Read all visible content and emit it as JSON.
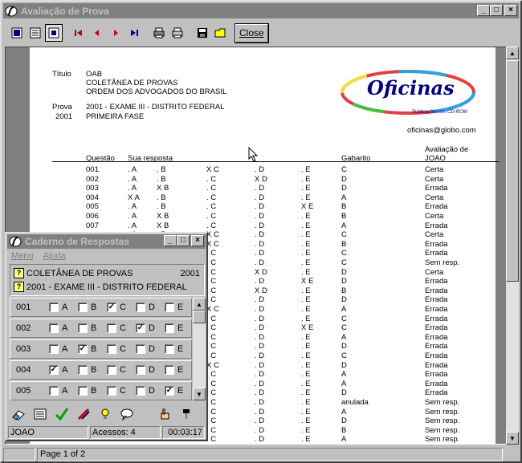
{
  "window": {
    "title": "Avaliação de Prova",
    "minimize": "_",
    "maximize": "□",
    "close": "×"
  },
  "toolbar": {
    "close_label": "Close"
  },
  "status": {
    "page": "Page 1 of 2"
  },
  "report": {
    "titulo_label": "Título",
    "titulo_lines": [
      "OAB",
      "COLETÂNEA DE PROVAS",
      "ORDEM DOS ADVOGADOS DO BRASIL"
    ],
    "prova_label": "Prova",
    "prova_year": "2001",
    "prova_lines": [
      "2001 - EXAME III - DISTRITO FEDERAL",
      "PRIMEIRA FASE"
    ],
    "logo_text": "Oficinas",
    "logo_sub": "Publicações em CD-ROM",
    "email": "oficinas@globo.com",
    "headers": {
      "questao": "Questão",
      "resposta": "Sua resposta",
      "gabarito": "Gabarito",
      "aval1": "Avaliação de",
      "aval2": "JOAO"
    },
    "rows": [
      {
        "q": "001",
        "marks": [
          ".",
          " .",
          "X",
          ".",
          " .",
          "."
        ],
        "g": "C",
        "r": "Certa"
      },
      {
        "q": "002",
        "marks": [
          ".",
          ".",
          ".",
          "X",
          ".",
          "."
        ],
        "g": "D",
        "r": "Certa"
      },
      {
        "q": "003",
        "marks": [
          ".",
          "X",
          ".",
          ".",
          ".",
          "."
        ],
        "g": "D",
        "r": "Errada"
      },
      {
        "q": "004",
        "marks": [
          "X",
          ".",
          ".",
          ".",
          ".",
          "."
        ],
        "g": "A",
        "r": "Certa"
      },
      {
        "q": "005",
        "marks": [
          ".",
          ".",
          ".",
          ".",
          "X",
          "."
        ],
        "g": "B",
        "r": "Errada"
      },
      {
        "q": "006",
        "marks": [
          ".",
          "X",
          ".",
          ".",
          ".",
          "."
        ],
        "g": "B",
        "r": "Certa"
      },
      {
        "q": "007",
        "marks": [
          ".",
          "X",
          ".",
          ".",
          ".",
          "."
        ],
        "g": "A",
        "r": "Errada"
      },
      {
        "q": "",
        "marks": [
          "",
          "",
          "X",
          "",
          "",
          ""
        ],
        "g": "C",
        "r": "Certa"
      },
      {
        "q": "",
        "marks": [
          "",
          "",
          "X",
          "",
          "",
          ""
        ],
        "g": "B",
        "r": "Errada"
      },
      {
        "q": "",
        "marks": [
          "",
          "",
          "",
          "",
          "",
          ""
        ],
        "g": "C",
        "r": "Errada"
      },
      {
        "q": "",
        "marks": [
          "",
          "",
          "",
          "",
          "",
          ""
        ],
        "g": "C",
        "r": "Sem resp."
      },
      {
        "q": "",
        "marks": [
          "",
          "",
          "",
          "X",
          "",
          ""
        ],
        "g": "D",
        "r": "Certa"
      },
      {
        "q": "",
        "marks": [
          "",
          "",
          "",
          "",
          "X",
          ""
        ],
        "g": "D",
        "r": "Errada"
      },
      {
        "q": "",
        "marks": [
          "",
          "",
          "",
          "X",
          "",
          ""
        ],
        "g": "B",
        "r": "Errada"
      },
      {
        "q": "",
        "marks": [
          "",
          "",
          "",
          "",
          "",
          ""
        ],
        "g": "D",
        "r": "Errada"
      },
      {
        "q": "",
        "marks": [
          "",
          "",
          "X",
          "",
          "",
          ""
        ],
        "g": "A",
        "r": "Errada"
      },
      {
        "q": "",
        "marks": [
          "",
          "",
          "",
          "",
          "",
          ""
        ],
        "g": "C",
        "r": "Errada"
      },
      {
        "q": "",
        "marks": [
          "",
          "",
          "",
          "",
          "X",
          ""
        ],
        "g": "C",
        "r": "Errada"
      },
      {
        "q": "",
        "marks": [
          "",
          "",
          "",
          "",
          "",
          ""
        ],
        "g": "A",
        "r": "Errada"
      },
      {
        "q": "",
        "marks": [
          "",
          "",
          "",
          "",
          "",
          ""
        ],
        "g": "D",
        "r": "Errada"
      },
      {
        "q": "",
        "marks": [
          "",
          "",
          "",
          "",
          "",
          ""
        ],
        "g": "C",
        "r": "Errada"
      },
      {
        "q": "",
        "marks": [
          "",
          "",
          "X",
          "",
          "",
          ""
        ],
        "g": "D",
        "r": "Errada"
      },
      {
        "q": "",
        "marks": [
          "",
          "",
          "",
          "",
          "",
          ""
        ],
        "g": "A",
        "r": "Errada"
      },
      {
        "q": "",
        "marks": [
          "",
          "",
          "",
          "",
          "",
          ""
        ],
        "g": "A",
        "r": "Errada"
      },
      {
        "q": "",
        "marks": [
          "",
          "",
          "",
          "",
          "",
          ""
        ],
        "g": "D",
        "r": "Errada"
      },
      {
        "q": "",
        "marks": [
          "",
          "",
          "",
          "",
          "",
          ""
        ],
        "g": "anulada",
        "r": "Sem resp."
      },
      {
        "q": "",
        "marks": [
          "",
          "",
          "",
          "",
          "",
          ""
        ],
        "g": "A",
        "r": "Sem resp."
      },
      {
        "q": "",
        "marks": [
          "",
          "",
          "",
          "",
          "",
          ""
        ],
        "g": "D",
        "r": "Sem resp."
      },
      {
        "q": "",
        "marks": [
          "",
          "",
          "",
          "",
          "",
          ""
        ],
        "g": "B",
        "r": "Sem resp."
      },
      {
        "q": "",
        "marks": [
          "",
          "",
          "",
          "",
          "",
          ""
        ],
        "g": "A",
        "r": "Sem resp."
      }
    ]
  },
  "caderno": {
    "title": "Caderno de Respostas",
    "menu": [
      "Menu",
      "Ajuda"
    ],
    "line1": "COLETÂNEA DE PROVAS",
    "line1_year": "2001",
    "line2": "2001 - EXAME III - DISTRITO FEDERAL",
    "options": [
      "A",
      "B",
      "C",
      "D",
      "E"
    ],
    "questions": [
      {
        "num": "001",
        "checked": [
          false,
          false,
          true,
          false,
          false
        ]
      },
      {
        "num": "002",
        "checked": [
          false,
          false,
          false,
          true,
          false
        ]
      },
      {
        "num": "003",
        "checked": [
          false,
          true,
          false,
          false,
          false
        ]
      },
      {
        "num": "004",
        "checked": [
          true,
          false,
          false,
          false,
          false
        ]
      },
      {
        "num": "005",
        "checked": [
          false,
          false,
          false,
          false,
          true
        ]
      }
    ],
    "status_user": "JOAO",
    "status_access": "Acessos: 4",
    "status_time": "00:03:17"
  }
}
